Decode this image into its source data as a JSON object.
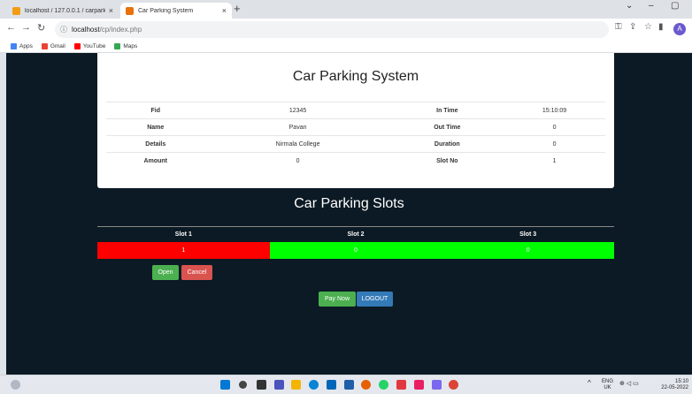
{
  "browser": {
    "tabs": [
      {
        "label": "localhost / 127.0.0.1 / carparking",
        "icon": "phpmyadmin-icon",
        "color": "#f39c12"
      },
      {
        "label": "Car Parking System",
        "icon": "page-icon",
        "color": "#e8710a"
      }
    ],
    "url_host": "localhost",
    "url_path": "/cp/index.php",
    "bookmarks": [
      {
        "label": "Apps",
        "color": "#4285f4"
      },
      {
        "label": "Gmail",
        "color": "#ea4335"
      },
      {
        "label": "YouTube",
        "color": "#ff0000"
      },
      {
        "label": "Maps",
        "color": "#34a853"
      }
    ],
    "profile_initial": "A"
  },
  "app": {
    "title": "Car Parking System",
    "info_rows": [
      {
        "k1": "Fid",
        "v1": "12345",
        "k2": "In Time",
        "v2": "15:10:09"
      },
      {
        "k1": "Name",
        "v1": "Pavan",
        "k2": "Out Time",
        "v2": "0"
      },
      {
        "k1": "Details",
        "v1": "Nirmala College",
        "k2": "Duration",
        "v2": "0"
      },
      {
        "k1": "Amount",
        "v1": "0",
        "k2": "Slot No",
        "v2": "1"
      }
    ],
    "slots_title": "Car Parking Slots",
    "slots": [
      {
        "label": "Slot 1",
        "value": "1",
        "color": "#ff0000"
      },
      {
        "label": "Slot 2",
        "value": "0",
        "color": "#00ff00"
      },
      {
        "label": "Slot 3",
        "value": "0",
        "color": "#00ff00"
      }
    ],
    "buttons": {
      "open": "Open",
      "cancel": "Cancel",
      "pay": "Pay Now",
      "logout": "LOGOUT"
    }
  },
  "taskbar": {
    "lang_top": "ENG",
    "lang_bottom": "UK",
    "time": "15:10",
    "date": "22-05-2022"
  }
}
